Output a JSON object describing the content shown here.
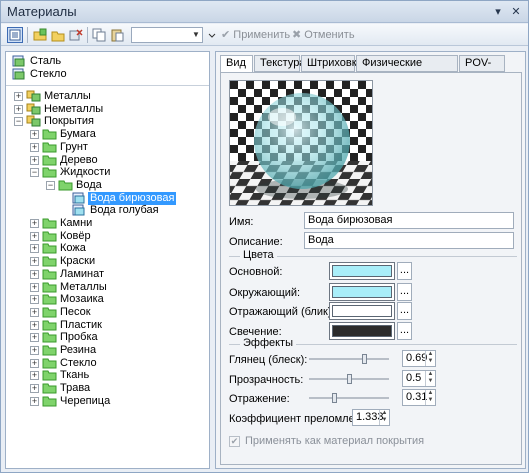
{
  "window": {
    "title": "Материалы"
  },
  "toolbar": {
    "apply_label": "Применить",
    "cancel_label": "Отменить",
    "combo_value": ""
  },
  "top_materials": [
    {
      "label": "Сталь"
    },
    {
      "label": "Стекло"
    }
  ],
  "tree": {
    "metals": "Металлы",
    "nonmetals": "Неметаллы",
    "coatings": "Покрытия",
    "coating_children": [
      "Бумага",
      "Грунт",
      "Дерево",
      "Жидкости"
    ],
    "liquids_children": [
      "Вода"
    ],
    "water_children": [
      "Вода бирюзовая",
      "Вода голубая"
    ],
    "coating_children_after": [
      "Камни",
      "Ковёр",
      "Кожа",
      "Краски",
      "Ламинат",
      "Металлы",
      "Мозаика",
      "Песок",
      "Пластик",
      "Пробка",
      "Резина",
      "Стекло",
      "Ткань",
      "Трава",
      "Черепица"
    ],
    "selected": "Вода бирюзовая"
  },
  "tabs": [
    "Вид",
    "Текстура",
    "Штриховка",
    "Физические свойства",
    "POV-Ray"
  ],
  "active_tab": "Вид",
  "props": {
    "name_label": "Имя:",
    "name_value": "Вода бирюзовая",
    "desc_label": "Описание:",
    "desc_value": "Вода",
    "colors_group": "Цвета",
    "base_label": "Основной:",
    "ambient_label": "Окружающий:",
    "specular_label": "Отражающий (блик):",
    "emission_label": "Свечение:",
    "effects_group": "Эффекты",
    "gloss_label": "Глянец (блеск):",
    "gloss_value": "0.69",
    "transp_label": "Прозрачность:",
    "transp_value": "0.5",
    "refl_label": "Отражение:",
    "refl_value": "0.31",
    "ior_label": "Коэффициент преломления:",
    "ior_value": "1.333",
    "apply_as_coating": "Применять как материал покрытия",
    "dots": "..."
  },
  "colors": {
    "base": "#a9eef9",
    "ambient": "#a9eef9",
    "specular": "#ffffff",
    "emission": "#2b2b2b",
    "accent": "#3399ff",
    "folder": "#58c24a"
  }
}
